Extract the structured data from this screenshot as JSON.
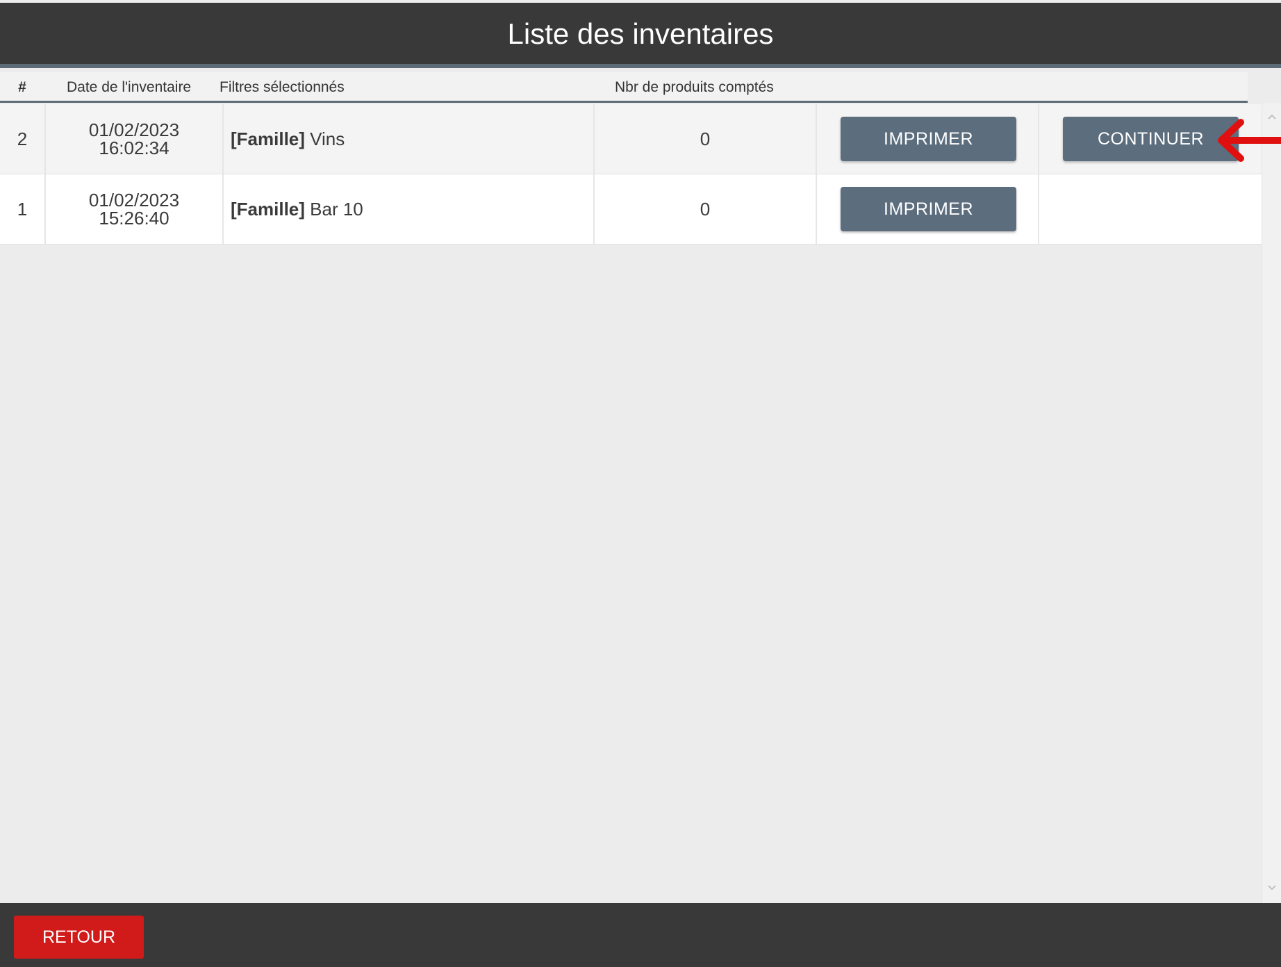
{
  "header": {
    "title": "Liste des inventaires"
  },
  "table": {
    "columns": {
      "num": "#",
      "date": "Date de l'inventaire",
      "filters": "Filtres sélectionnés",
      "count": "Nbr de produits comptés"
    },
    "rows": [
      {
        "num": "2",
        "date": "01/02/2023",
        "time": "16:02:34",
        "filter_tag": "[Famille]",
        "filter_value": " Vins",
        "count": "0",
        "print_label": "IMPRIMER",
        "continue_label": "CONTINUER"
      },
      {
        "num": "1",
        "date": "01/02/2023",
        "time": "15:26:40",
        "filter_tag": "[Famille]",
        "filter_value": " Bar 10",
        "count": "0",
        "print_label": "IMPRIMER"
      }
    ]
  },
  "scrollbar": {
    "up_icon": "chevron-up-icon",
    "down_icon": "chevron-down-icon"
  },
  "annotation": {
    "icon": "red-arrow-icon",
    "color": "#e01010"
  },
  "footer": {
    "back_label": "RETOUR"
  },
  "colors": {
    "bar": "#393939",
    "accent_line": "#5d6b78",
    "button": "#5c6d7e",
    "back_button": "#d11a1a"
  }
}
